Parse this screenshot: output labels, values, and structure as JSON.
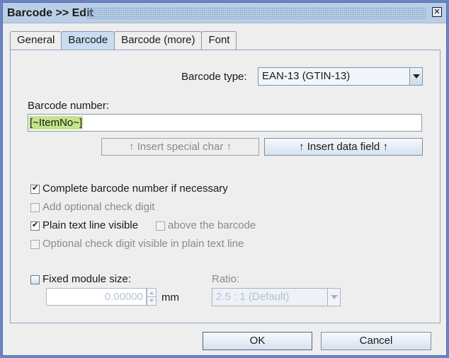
{
  "window": {
    "title": "Barcode >> Edit",
    "close_icon": "close-icon"
  },
  "tabs": [
    {
      "label": "General",
      "active": false
    },
    {
      "label": "Barcode",
      "active": true
    },
    {
      "label": "Barcode (more)",
      "active": false
    },
    {
      "label": "Font",
      "active": false
    }
  ],
  "barcode_type": {
    "label": "Barcode type:",
    "value": "EAN-13 (GTIN-13)"
  },
  "barcode_number": {
    "label": "Barcode number:",
    "value": "[~ItemNo~]"
  },
  "buttons": {
    "insert_special_char": "↑ Insert special char ↑",
    "insert_data_field": "↑ Insert data field ↑",
    "ok": "OK",
    "cancel": "Cancel"
  },
  "options": {
    "complete_number": {
      "label": "Complete barcode number if necessary",
      "checked": true,
      "enabled": true
    },
    "add_check_digit": {
      "label": "Add optional check digit",
      "checked": false,
      "enabled": false
    },
    "plain_text_visible": {
      "label": "Plain text line visible",
      "checked": true,
      "enabled": true
    },
    "above_barcode": {
      "label": "above the barcode",
      "checked": false,
      "enabled": false
    },
    "check_digit_in_plain": {
      "label": "Optional check digit visible in plain text line",
      "checked": false,
      "enabled": false
    }
  },
  "module_size": {
    "label": "Fixed module size:",
    "checked": false,
    "value": "0.00000",
    "unit": "mm"
  },
  "ratio": {
    "label": "Ratio:",
    "value": "2.5 : 1  (Default)"
  }
}
